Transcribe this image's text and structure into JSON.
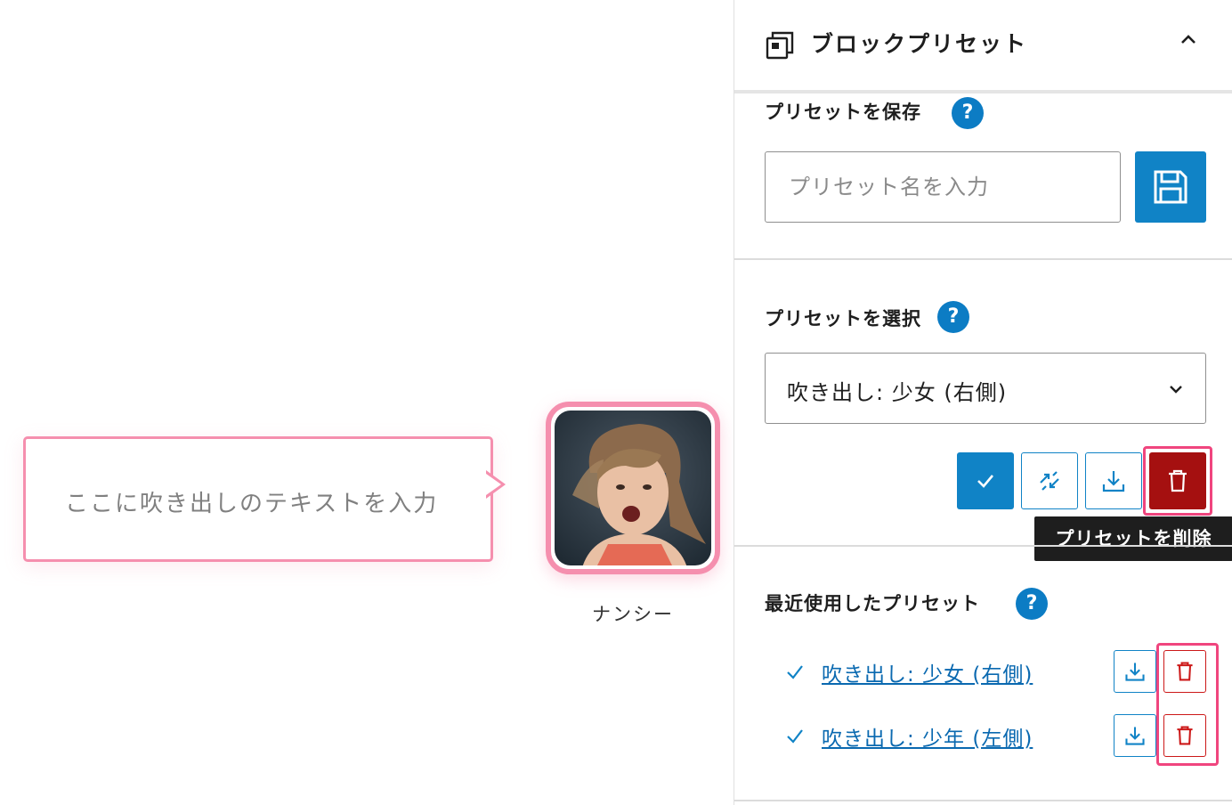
{
  "editor": {
    "bubble": {
      "placeholder_text": "ここに吹き出しのテキストを入力"
    },
    "avatar": {
      "name": "ナンシー"
    }
  },
  "sidebar": {
    "panel": {
      "title": "ブロックプリセット",
      "icon": "block-preset-icon",
      "toggle_icon": "chevron-up-icon"
    },
    "save_section": {
      "label": "プリセットを保存",
      "help": "?",
      "input_placeholder": "プリセット名を入力",
      "input_value": "",
      "save_icon": "floppy-disk-icon"
    },
    "select_section": {
      "label": "プリセットを選択",
      "help": "?",
      "selected": "吹き出し: 少女 (右側)",
      "actions": [
        "apply-check-icon",
        "update-sync-icon",
        "export-download-icon",
        "delete-trash-icon"
      ]
    },
    "tooltip": {
      "text": "プリセットを削除"
    },
    "recent_section": {
      "label": "最近使用したプリセット",
      "help": "?",
      "items": [
        {
          "name": "吹き出し: 少女 (右側)"
        },
        {
          "name": "吹き出し: 少年 (左側)"
        }
      ]
    }
  },
  "colors": {
    "accent_blue": "#1083c6",
    "delete_red": "#a51010",
    "highlight_pink": "#f0457e",
    "bubble_pink": "#f58fae"
  }
}
